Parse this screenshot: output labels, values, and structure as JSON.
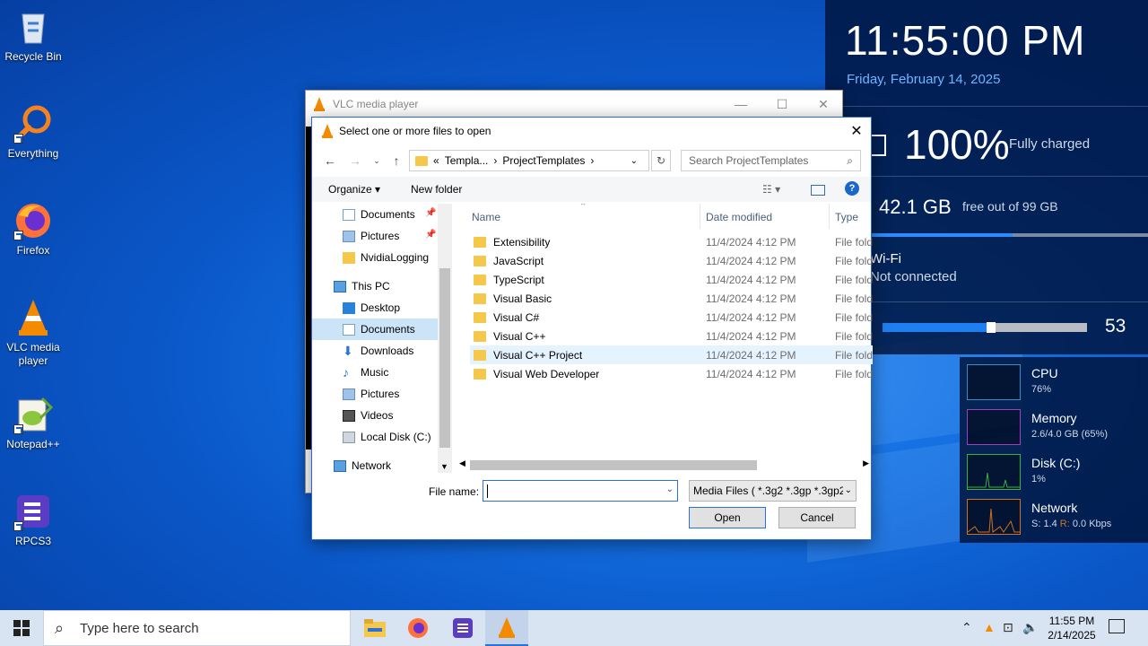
{
  "desktop": {
    "icons": [
      {
        "label": "Recycle Bin"
      },
      {
        "label": "Everything"
      },
      {
        "label": "Firefox"
      },
      {
        "label": "VLC media player"
      },
      {
        "label": "Notepad++"
      },
      {
        "label": "RPCS3"
      }
    ]
  },
  "widget": {
    "clock": "11:55:00 PM",
    "date": "Friday, February 14, 2025",
    "battery_pct": "100%",
    "battery_status": "Fully charged",
    "disk_gb": "42.1 GB",
    "disk_free": "free out of 99 GB",
    "disk_used_fraction": 0.58,
    "wifi_title": "Wi-Fi",
    "wifi_status": "Not connected",
    "volume": "53",
    "volume_fraction": 0.53,
    "monitors": [
      {
        "title": "CPU",
        "value": "76%",
        "color": "#3c8cc8"
      },
      {
        "title": "Memory",
        "value": "2.6/4.0 GB (65%)",
        "color": "#a040c0"
      },
      {
        "title": "Disk (C:)",
        "value": "1%",
        "color": "#3cb040"
      },
      {
        "title": "Network",
        "value_prefix": "S: 1.4 ",
        "value_r": "R:",
        "value_suffix": " 0.0 Kbps",
        "color": "#d07020"
      }
    ]
  },
  "vlc": {
    "title": "VLC media player",
    "minimize": "—",
    "maximize": "☐",
    "close": "✕"
  },
  "dialog": {
    "title": "Select one or more files to open",
    "close": "✕",
    "address": {
      "prefix": "«",
      "crumb1": "Templa...",
      "sep": "›",
      "crumb2": "ProjectTemplates"
    },
    "search_placeholder": "Search ProjectTemplates",
    "organize": "Organize ▾",
    "new_folder": "New folder",
    "nav": [
      {
        "label": "Documents",
        "pinned": true
      },
      {
        "label": "Pictures",
        "pinned": true
      },
      {
        "label": "NvidiaLogging",
        "pinned": false
      },
      {
        "label": "This PC"
      },
      {
        "label": "Desktop"
      },
      {
        "label": "Documents",
        "selected": true
      },
      {
        "label": "Downloads"
      },
      {
        "label": "Music"
      },
      {
        "label": "Pictures"
      },
      {
        "label": "Videos"
      },
      {
        "label": "Local Disk (C:)"
      },
      {
        "label": "Network"
      }
    ],
    "columns": {
      "name": "Name",
      "date": "Date modified",
      "type": "Type"
    },
    "files": [
      {
        "name": "Extensibility",
        "date": "11/4/2024 4:12 PM",
        "type": "File fold"
      },
      {
        "name": "JavaScript",
        "date": "11/4/2024 4:12 PM",
        "type": "File fold"
      },
      {
        "name": "TypeScript",
        "date": "11/4/2024 4:12 PM",
        "type": "File fold"
      },
      {
        "name": "Visual Basic",
        "date": "11/4/2024 4:12 PM",
        "type": "File fold"
      },
      {
        "name": "Visual C#",
        "date": "11/4/2024 4:12 PM",
        "type": "File fold"
      },
      {
        "name": "Visual C++",
        "date": "11/4/2024 4:12 PM",
        "type": "File fold"
      },
      {
        "name": "Visual C++ Project",
        "date": "11/4/2024 4:12 PM",
        "type": "File fold"
      },
      {
        "name": "Visual Web Developer",
        "date": "11/4/2024 4:12 PM",
        "type": "File fold"
      }
    ],
    "file_name_label": "File name:",
    "file_name_value": "",
    "file_type": "Media Files ( *.3g2 *.3gp *.3gp2",
    "open": "Open",
    "cancel": "Cancel"
  },
  "taskbar": {
    "search_placeholder": "Type here to search",
    "time": "11:55 PM",
    "date": "2/14/2025"
  }
}
